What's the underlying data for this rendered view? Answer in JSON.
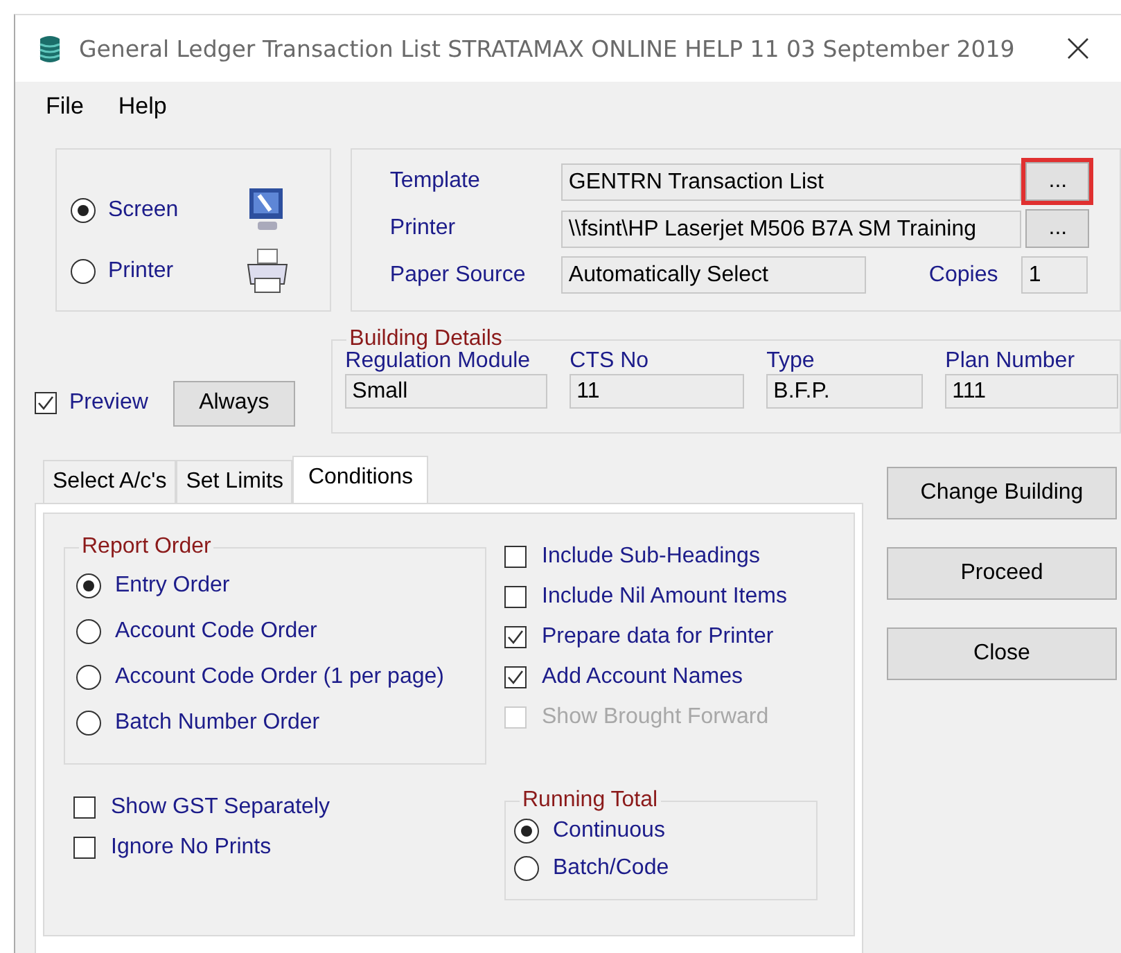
{
  "window": {
    "title": "General Ledger Transaction List STRATAMAX ONLINE HELP 11 03 September 2019"
  },
  "menu": [
    "File",
    "Help"
  ],
  "output": [
    {
      "label": "Screen",
      "selected": true,
      "kind": "monitor"
    },
    {
      "label": "Printer",
      "selected": false,
      "kind": "printer"
    }
  ],
  "report_settings": {
    "template": {
      "label": "Template",
      "value": "GENTRN Transaction List",
      "browse": "...",
      "highlighted": true
    },
    "printer": {
      "label": "Printer",
      "value": "\\\\fsint\\HP Laserjet M506 B7A SM Training",
      "browse": "...",
      "highlighted": false
    },
    "paper_source": {
      "label": "Paper Source",
      "value": "Automatically Select"
    },
    "copies": {
      "label": "Copies",
      "value": "1"
    }
  },
  "preview": {
    "label": "Preview",
    "checked": true
  },
  "always_button": "Always",
  "building_details": {
    "title": "Building Details",
    "fields": [
      {
        "label": "Regulation Module",
        "value": "Small"
      },
      {
        "label": "CTS No",
        "value": "11"
      },
      {
        "label": "Type",
        "value": "B.F.P."
      },
      {
        "label": "Plan Number",
        "value": "111"
      }
    ]
  },
  "tabs": [
    {
      "label": "Select A/c's",
      "selected": false
    },
    {
      "label": "Set Limits",
      "selected": false
    },
    {
      "label": "Conditions",
      "selected": true
    }
  ],
  "report_order": {
    "title": "Report Order",
    "options": [
      {
        "label": "Entry Order",
        "selected": true
      },
      {
        "label": "Account Code Order",
        "selected": false
      },
      {
        "label": "Account Code Order (1 per page)",
        "selected": false
      },
      {
        "label": "Batch Number Order",
        "selected": false
      }
    ]
  },
  "options": [
    {
      "label": "Include Sub-Headings",
      "checked": false,
      "disabled": false
    },
    {
      "label": "Include Nil Amount Items",
      "checked": false,
      "disabled": false
    },
    {
      "label": "Prepare data for Printer",
      "checked": true,
      "disabled": false
    },
    {
      "label": "Add Account Names",
      "checked": true,
      "disabled": false
    },
    {
      "label": "Show Brought Forward",
      "checked": false,
      "disabled": true
    }
  ],
  "extra_options": [
    {
      "label": "Show GST Separately",
      "checked": false
    },
    {
      "label": "Ignore No Prints",
      "checked": false
    }
  ],
  "running_total": {
    "title": "Running Total",
    "options": [
      {
        "label": "Continuous",
        "selected": true
      },
      {
        "label": "Batch/Code",
        "selected": false
      }
    ]
  },
  "buttons": [
    "Change Building",
    "Proceed",
    "Close"
  ]
}
